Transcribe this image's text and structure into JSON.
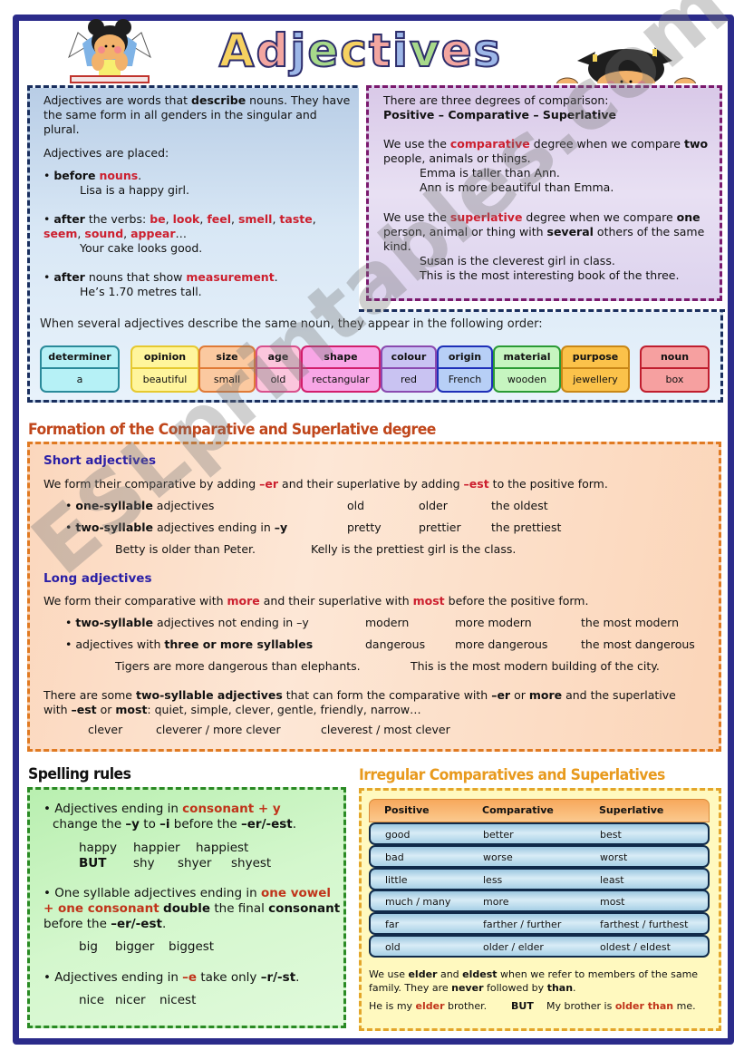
{
  "title": "Adjectives",
  "title_letter_colors": [
    "#f6d160",
    "#f3a6a0",
    "#9db7e8",
    "#a7d98a",
    "#f6d160",
    "#f3a6a0",
    "#9db7e8",
    "#a7d98a",
    "#f3a6a0",
    "#9db7e8"
  ],
  "intro": {
    "p1_a": "Adjectives are words that ",
    "p1_b": "describe",
    "p1_c": " nouns. They have the same form in all genders in the singular and plural.",
    "p2": "Adjectives are placed:",
    "b1_a": "before",
    "b1_b": "nouns",
    "b1_c": ".",
    "b1_ex": "Lisa is a happy girl.",
    "b2_a": "after",
    "b2_b": " the verbs: ",
    "b2_verbs": [
      "be",
      "look",
      "feel",
      "smell",
      "taste",
      "seem",
      "sound",
      "appear"
    ],
    "b2_ex": "Your cake looks good.",
    "b3_a": "after",
    "b3_b": " nouns that show ",
    "b3_c": "measurement",
    "b3_ex": "He’s 1.70 metres tall."
  },
  "degrees": {
    "l1": "There are three degrees of comparison:",
    "l2": "Positive – Comparative – Superlative",
    "comp_a": "We use the ",
    "comp_b": "comparative",
    "comp_c": " degree when we compare ",
    "comp_d": "two",
    "comp_e": " people, animals or things.",
    "comp_ex1": "Emma is taller than Ann.",
    "comp_ex2": "Ann is more beautiful than Emma.",
    "sup_a": "We use the ",
    "sup_b": "superlative",
    "sup_c": " degree when we compare ",
    "sup_d": "one",
    "sup_e": " person, animal or thing with ",
    "sup_f": "several",
    "sup_g": " others of the same kind.",
    "sup_ex1": "Susan is the cleverest girl in class.",
    "sup_ex2": "This is the most interesting book of the three."
  },
  "order": {
    "intro": "When several adjectives describe the same noun, they appear in the following order:",
    "items": [
      {
        "label": "determiner",
        "example": "a",
        "color": "#b6f1f6",
        "border": "#2a8a9a"
      },
      {
        "label": "opinion",
        "example": "beautiful",
        "color": "#fff59c",
        "border": "#e6c930"
      },
      {
        "label": "size",
        "example": "small",
        "color": "#fbc9a0",
        "border": "#e07a36"
      },
      {
        "label": "age",
        "example": "old",
        "color": "#fbc6dc",
        "border": "#d9508c"
      },
      {
        "label": "shape",
        "example": "rectangular",
        "color": "#f8a6e6",
        "border": "#d21e6c"
      },
      {
        "label": "colour",
        "example": "red",
        "color": "#c9c3f2",
        "border": "#8a4ab0"
      },
      {
        "label": "origin",
        "example": "French",
        "color": "#b7cff6",
        "border": "#1e2fb8"
      },
      {
        "label": "material",
        "example": "wooden",
        "color": "#c6f5c0",
        "border": "#2a9a34"
      },
      {
        "label": "purpose",
        "example": "jewellery",
        "color": "#fbc24a",
        "border": "#c98716"
      },
      {
        "label": "noun",
        "example": "box",
        "color": "#f6a0a0",
        "border": "#c01e2e"
      }
    ]
  },
  "formation": {
    "heading": "Formation of the Comparative and Superlative degree",
    "short_title": "Short adjectives",
    "short_rule_a": "We form their comparative by adding ",
    "short_rule_b": "–er",
    "short_rule_c": " and their superlative by adding ",
    "short_rule_d": "–est",
    "short_rule_e": " to the positive form.",
    "short_rows": [
      {
        "bold": "one-syllable",
        "rest": " adjectives",
        "pos": "old",
        "comp": "older",
        "sup": "the oldest"
      },
      {
        "bold": "two-syllable",
        "rest": " adjectives ending in ",
        "tail": "–y",
        "pos": "pretty",
        "comp": "prettier",
        "sup": "the prettiest"
      }
    ],
    "short_ex1": "Betty is older than Peter.",
    "short_ex2": "Kelly is the prettiest girl is the class.",
    "long_title": "Long adjectives",
    "long_rule_a": "We form their comparative with ",
    "long_rule_b": "more",
    "long_rule_c": " and their superlative with ",
    "long_rule_d": "most",
    "long_rule_e": " before the positive form.",
    "long_rows": [
      {
        "pre": "",
        "bold": "two-syllable",
        "rest": " adjectives not ending in –y",
        "pos": "modern",
        "comp": "more modern",
        "sup": "the most modern"
      },
      {
        "pre": "adjectives with ",
        "bold": "three or more syllables",
        "rest": "",
        "pos": "dangerous",
        "comp": "more dangerous",
        "sup": "the most dangerous"
      }
    ],
    "long_ex1": "Tigers are more dangerous than elephants.",
    "long_ex2": "This is the most modern building of the city.",
    "some_a": "There are some ",
    "some_b": "two-syllable adjectives",
    "some_c": " that can form the comparative with ",
    "some_d": "–er",
    "some_e": " or ",
    "some_f": "more",
    "some_g": " and the superlative with ",
    "some_h": "–est",
    "some_i": " or ",
    "some_j": "most",
    "some_k": ": quiet, simple, clever, gentle, friendly, narrow…",
    "some_ex": [
      "clever",
      "cleverer / more clever",
      "cleverest / most clever"
    ]
  },
  "spelling": {
    "heading": "Spelling rules",
    "r1_a": "Adjectives ending in ",
    "r1_b": "consonant + y",
    "r1_c": "change the ",
    "r1_d": "–y",
    "r1_e": " to ",
    "r1_f": "–i",
    "r1_g": " before the ",
    "r1_h": "–er/-est",
    "r1_i": ".",
    "r1_ex1": [
      "happy",
      "happier",
      "happiest"
    ],
    "r1_ex2": [
      "BUT",
      "shy",
      "shyer",
      "shyest"
    ],
    "r2_a": "One syllable adjectives ending in ",
    "r2_b": "one vowel + one consonant",
    "r2_c": " ",
    "r2_d": "double",
    "r2_e": " the final ",
    "r2_f": "consonant",
    "r2_g": " before the ",
    "r2_h": "–er/-est",
    "r2_i": ".",
    "r2_ex": [
      "big",
      "bigger",
      "biggest"
    ],
    "r3_a": "Adjectives ending in ",
    "r3_b": "–e",
    "r3_c": " take only ",
    "r3_d": "–r/-st",
    "r3_e": ".",
    "r3_ex": [
      "nice",
      "nicer",
      "nicest"
    ]
  },
  "irregular": {
    "heading": "Irregular Comparatives and Superlatives",
    "columns": [
      "Positive",
      "Comparative",
      "Superlative"
    ],
    "rows": [
      [
        "good",
        "better",
        "best"
      ],
      [
        "bad",
        "worse",
        "worst"
      ],
      [
        "little",
        "less",
        "least"
      ],
      [
        "much / many",
        "more",
        "most"
      ],
      [
        "far",
        "farther / further",
        "farthest / furthest"
      ],
      [
        "old",
        "older / elder",
        "oldest / eldest"
      ]
    ],
    "note_a": "We use ",
    "note_b": "elder",
    "note_c": " and ",
    "note_d": "eldest",
    "note_e": " when we refer to members of the same family. They are ",
    "note_f": "never",
    "note_g": " followed by ",
    "note_h": "than",
    "note_i": ".",
    "ex_a": "He is my ",
    "ex_b": "elder",
    "ex_c": " brother.",
    "ex_but": "BUT",
    "ex_d": "My brother is ",
    "ex_e": "older than",
    "ex_f": " me."
  },
  "watermark": "ESLprintables.com",
  "colors": {
    "frame": "#2b2b8a",
    "red_text": "#cc1f2e",
    "sub_heading": "#2a1fa6",
    "formation_heading": "#c0461b",
    "irregular_heading": "#e89a1e"
  }
}
